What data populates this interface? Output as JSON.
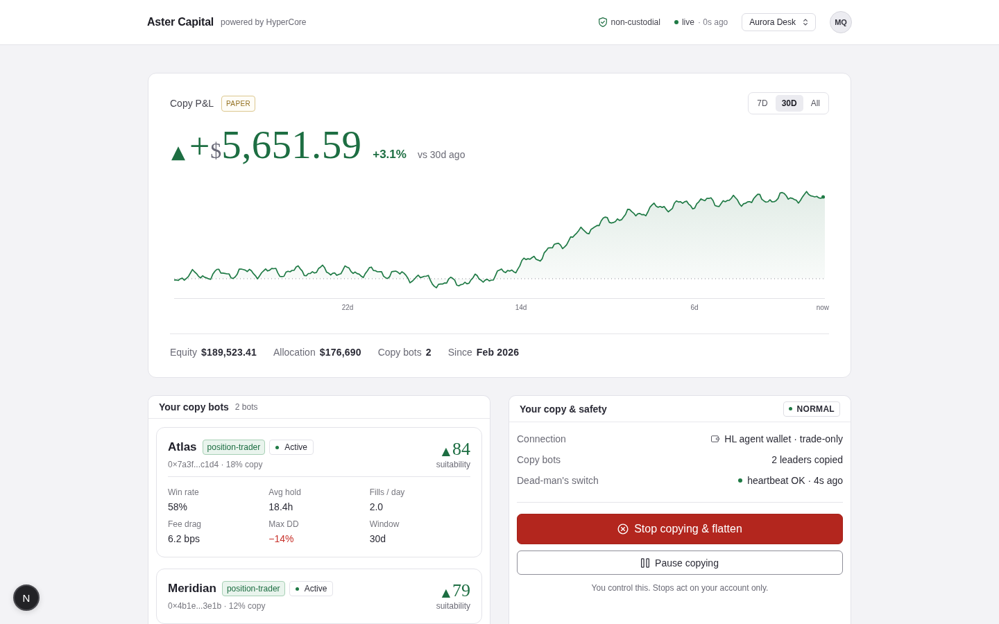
{
  "header": {
    "brand": "Aster Capital",
    "tagline": "powered by HyperCore",
    "custody": "non-custodial",
    "live": {
      "label": "live",
      "on": true,
      "age": "· 0s ago"
    },
    "desk": "Aurora Desk",
    "avatar": "MQ"
  },
  "pnl_card": {
    "title": "Copy P&L",
    "badge": "PAPER",
    "ranges": [
      {
        "label": "7D",
        "selected": false
      },
      {
        "label": "30D",
        "selected": true
      },
      {
        "label": "All",
        "selected": false
      }
    ],
    "positive": true,
    "arrow": "▲",
    "sign": "+",
    "currency": "$",
    "amount": "5,651.59",
    "change": "+3.1%",
    "comparison": "vs 30d ago",
    "chart": {
      "x_labels": [
        "22d",
        "14d",
        "6d",
        "now"
      ]
    },
    "stats": [
      {
        "label": "Equity",
        "value": "$189,523.41"
      },
      {
        "label": "Allocation",
        "value": "$176,690"
      },
      {
        "label": "Copy bots",
        "value": "2"
      },
      {
        "label": "Since",
        "value": "Feb 2026"
      }
    ]
  },
  "bots_panel": {
    "title": "Your copy bots",
    "count": "2 bots",
    "bots": [
      {
        "name": "Atlas",
        "tag": "position-trader",
        "status": "Active",
        "active": true,
        "meta": "0×7a3f...c1d4 · 18% copy",
        "positive": true,
        "arrow": "▲",
        "score": "84",
        "score_label": "suitability",
        "metrics": [
          {
            "label": "Win rate",
            "value": "58%",
            "negative": false
          },
          {
            "label": "Avg hold",
            "value": "18.4h",
            "negative": false
          },
          {
            "label": "Fills / day",
            "value": "2.0",
            "negative": false
          },
          {
            "label": "Fee drag",
            "value": "6.2 bps",
            "negative": false
          },
          {
            "label": "Max DD",
            "value": "−14%",
            "negative": true
          },
          {
            "label": "Window",
            "value": "30d",
            "negative": false
          }
        ]
      },
      {
        "name": "Meridian",
        "tag": "position-trader",
        "status": "Active",
        "active": true,
        "meta": "0×4b1e...3e1b · 12% copy",
        "positive": true,
        "arrow": "▲",
        "score": "79",
        "score_label": "suitability"
      }
    ]
  },
  "safety_panel": {
    "title": "Your copy & safety",
    "mode": {
      "label": "NORMAL",
      "ok": true
    },
    "rows": [
      {
        "kind": "icon",
        "label": "Connection",
        "value": "HL agent wallet · trade-only"
      },
      {
        "kind": "plain",
        "label": "Copy bots",
        "value": "2 leaders copied"
      },
      {
        "kind": "status",
        "label": "Dead-man's switch",
        "value": "heartbeat OK · 4s ago",
        "ok": true
      }
    ],
    "actions": [
      {
        "kind": "danger",
        "label": "Stop copying & flatten"
      },
      {
        "kind": "secondary",
        "label": "Pause copying"
      }
    ],
    "note": "You control this. Stops act on your account only."
  },
  "dev_indicator": "N"
}
